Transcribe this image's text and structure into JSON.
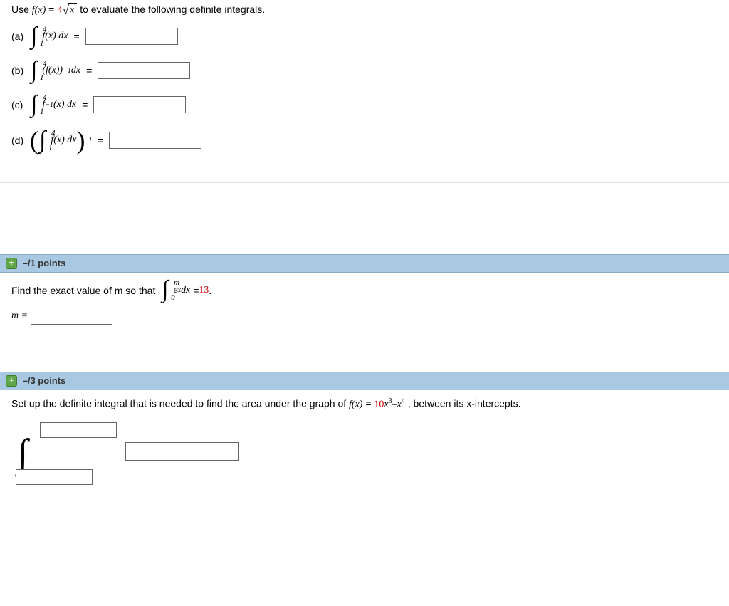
{
  "q1": {
    "prompt_pre": "Use ",
    "fx": "f(x)",
    "eq": " = ",
    "coef": "4",
    "sqrt_arg": "x",
    "prompt_post": " to evaluate the following definite integrals.",
    "parts": {
      "a": {
        "label": "(a)",
        "upper": "4",
        "lower": "1",
        "integrand_pre": "f(x) dx"
      },
      "b": {
        "label": "(b)",
        "upper": "4",
        "lower": "1",
        "integrand_pre": "(f(x))",
        "exp": "−1",
        "integrand_post": " dx"
      },
      "c": {
        "label": "(c)",
        "upper": "4",
        "lower": "1",
        "integrand_pre": "f",
        "exp": "−1",
        "integrand_mid": "(x) dx"
      },
      "d": {
        "label": "(d)",
        "upper": "4",
        "lower": "1",
        "integrand_pre": "f(x) dx",
        "outer_exp": "−1"
      }
    },
    "equals": "="
  },
  "q2": {
    "points": "–/1 points",
    "prompt": "Find the exact value of m so that",
    "upper": "m",
    "lower": "0",
    "integrand_base": "e",
    "integrand_exp": "x",
    "integrand_dx": " dx",
    "rhs_eq": "= ",
    "rhs_val": "13",
    "period": " .",
    "mlabel": "m ="
  },
  "q3": {
    "points": "–/3 points",
    "prompt_pre": "Set up the definite integral that is needed to find the area under the graph of ",
    "fx": "f(x)",
    "eq": " = ",
    "term1_coef": "10",
    "term1_var": "x",
    "term1_exp": "3",
    "minus": "–",
    "term2_var": "x",
    "term2_exp": "4",
    "prompt_post": " , between its x-intercepts."
  }
}
